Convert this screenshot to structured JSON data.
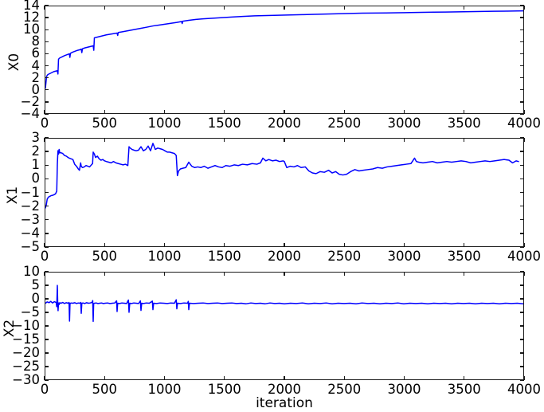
{
  "chart_data": [
    {
      "type": "line",
      "panel_index": 0,
      "title": "",
      "xlabel": "",
      "ylabel": "X0",
      "xlim": [
        0,
        4000
      ],
      "ylim": [
        -4,
        14
      ],
      "xticks": [
        0,
        500,
        1000,
        1500,
        2000,
        2500,
        3000,
        3500,
        4000
      ],
      "yticks": [
        -4,
        -2,
        0,
        2,
        4,
        6,
        8,
        10,
        12,
        14
      ],
      "grid": false,
      "legend": null,
      "line_color": "#0000ff",
      "series": [
        {
          "name": "X0",
          "x": [
            0,
            10,
            20,
            30,
            40,
            50,
            60,
            70,
            80,
            90,
            100,
            105,
            110,
            120,
            140,
            160,
            180,
            200,
            205,
            210,
            230,
            250,
            270,
            290,
            300,
            305,
            310,
            330,
            350,
            370,
            390,
            400,
            405,
            410,
            430,
            450,
            470,
            490,
            510,
            540,
            570,
            600,
            605,
            610,
            640,
            680,
            720,
            760,
            800,
            850,
            900,
            950,
            1000,
            1050,
            1100,
            1140,
            1145,
            1150,
            1200,
            1260,
            1320,
            1400,
            1480,
            1560,
            1650,
            1750,
            1850,
            1950,
            2050,
            2150,
            2250,
            2350,
            2450,
            2550,
            2650,
            2750,
            2850,
            2950,
            3050,
            3150,
            3250,
            3350,
            3450,
            3550,
            3650,
            3750,
            3850,
            3950,
            4000
          ],
          "y": [
            0.2,
            2.2,
            2.5,
            2.6,
            2.7,
            2.8,
            2.9,
            3.0,
            3.05,
            3.1,
            3.15,
            2.6,
            5.1,
            5.3,
            5.5,
            5.7,
            5.85,
            6.0,
            5.4,
            6.1,
            6.3,
            6.45,
            6.6,
            6.7,
            6.8,
            6.2,
            6.85,
            7.0,
            7.1,
            7.2,
            7.3,
            7.35,
            6.6,
            8.7,
            8.8,
            8.9,
            9.0,
            9.1,
            9.2,
            9.3,
            9.4,
            9.5,
            9.1,
            9.6,
            9.7,
            9.85,
            10.0,
            10.15,
            10.3,
            10.5,
            10.7,
            10.85,
            11.0,
            11.15,
            11.3,
            11.45,
            11.1,
            11.5,
            11.65,
            11.8,
            11.9,
            12.0,
            12.1,
            12.2,
            12.3,
            12.4,
            12.45,
            12.5,
            12.55,
            12.6,
            12.65,
            12.7,
            12.75,
            12.8,
            12.85,
            12.88,
            12.9,
            12.93,
            12.96,
            12.99,
            13.02,
            13.05,
            13.08,
            13.11,
            13.14,
            13.17,
            13.2,
            13.22,
            13.25
          ]
        }
      ]
    },
    {
      "type": "line",
      "panel_index": 1,
      "title": "",
      "xlabel": "",
      "ylabel": "X1",
      "xlim": [
        0,
        4000
      ],
      "ylim": [
        -5,
        3
      ],
      "xticks": [
        0,
        500,
        1000,
        1500,
        2000,
        2500,
        3000,
        3500,
        4000
      ],
      "yticks": [
        -5,
        -4,
        -3,
        -2,
        -1,
        0,
        1,
        2,
        3
      ],
      "grid": false,
      "legend": null,
      "line_color": "#0000ff",
      "series": [
        {
          "name": "X1",
          "x": [
            0,
            8,
            15,
            25,
            35,
            45,
            55,
            65,
            75,
            85,
            95,
            100,
            105,
            110,
            115,
            120,
            130,
            145,
            160,
            175,
            190,
            200,
            215,
            230,
            245,
            260,
            275,
            285,
            295,
            300,
            310,
            325,
            340,
            355,
            370,
            385,
            395,
            400,
            410,
            420,
            435,
            450,
            465,
            480,
            495,
            510,
            530,
            550,
            570,
            590,
            610,
            630,
            650,
            670,
            690,
            700,
            710,
            725,
            740,
            760,
            780,
            800,
            820,
            840,
            860,
            880,
            900,
            920,
            940,
            960,
            980,
            1000,
            1020,
            1040,
            1060,
            1080,
            1095,
            1105,
            1115,
            1130,
            1150,
            1175,
            1200,
            1225,
            1250,
            1275,
            1300,
            1330,
            1360,
            1390,
            1420,
            1450,
            1480,
            1510,
            1545,
            1580,
            1615,
            1650,
            1690,
            1730,
            1770,
            1800,
            1820,
            1845,
            1870,
            1900,
            1930,
            1960,
            1990,
            2000,
            2020,
            2050,
            2080,
            2110,
            2140,
            2175,
            2205,
            2235,
            2265,
            2300,
            2335,
            2370,
            2400,
            2430,
            2460,
            2490,
            2520,
            2555,
            2590,
            2625,
            2660,
            2700,
            2740,
            2780,
            2820,
            2860,
            2900,
            2940,
            2980,
            3020,
            3060,
            3090,
            3105,
            3125,
            3160,
            3200,
            3240,
            3280,
            3320,
            3360,
            3400,
            3440,
            3480,
            3520,
            3560,
            3600,
            3640,
            3680,
            3720,
            3760,
            3800,
            3840,
            3880,
            3910,
            3940,
            3960,
            3980,
            4000
          ],
          "y": [
            -2.15,
            -1.9,
            -1.5,
            -1.35,
            -1.3,
            -1.25,
            -1.22,
            -1.2,
            -1.15,
            -1.1,
            -0.9,
            1.1,
            2.1,
            1.85,
            2.2,
            1.95,
            1.95,
            1.9,
            1.75,
            1.7,
            1.6,
            1.55,
            1.5,
            1.45,
            1.1,
            0.95,
            0.75,
            0.65,
            1.2,
            0.95,
            0.85,
            0.9,
            1.0,
            0.95,
            0.9,
            1.05,
            1.15,
            2.0,
            1.85,
            1.6,
            1.7,
            1.5,
            1.4,
            1.45,
            1.35,
            1.3,
            1.25,
            1.2,
            1.3,
            1.2,
            1.15,
            1.1,
            1.05,
            1.1,
            1.0,
            2.4,
            2.3,
            2.2,
            2.15,
            2.1,
            2.15,
            2.4,
            2.1,
            2.2,
            2.45,
            2.1,
            2.65,
            2.2,
            2.3,
            2.25,
            2.2,
            2.1,
            2.0,
            2.0,
            1.95,
            1.9,
            1.75,
            0.25,
            0.6,
            0.75,
            0.8,
            0.85,
            1.25,
            0.95,
            0.85,
            0.9,
            0.85,
            0.95,
            0.8,
            0.9,
            1.0,
            0.9,
            0.85,
            1.0,
            0.95,
            1.05,
            1.0,
            1.1,
            1.05,
            1.15,
            1.1,
            1.2,
            1.55,
            1.35,
            1.45,
            1.35,
            1.4,
            1.3,
            1.35,
            1.3,
            0.85,
            0.95,
            0.9,
            1.0,
            0.85,
            0.9,
            0.6,
            0.45,
            0.4,
            0.55,
            0.5,
            0.65,
            0.45,
            0.55,
            0.35,
            0.3,
            0.35,
            0.55,
            0.7,
            0.6,
            0.65,
            0.7,
            0.75,
            0.85,
            0.8,
            0.9,
            0.95,
            1.0,
            1.05,
            1.1,
            1.15,
            1.55,
            1.3,
            1.25,
            1.2,
            1.25,
            1.3,
            1.2,
            1.25,
            1.3,
            1.25,
            1.3,
            1.35,
            1.3,
            1.2,
            1.25,
            1.3,
            1.35,
            1.3,
            1.35,
            1.4,
            1.45,
            1.4,
            1.2,
            1.35,
            1.3
          ]
        }
      ]
    },
    {
      "type": "line",
      "panel_index": 2,
      "title": "",
      "xlabel": "iteration",
      "ylabel": "X2",
      "xlim": [
        0,
        4000
      ],
      "ylim": [
        -30,
        10
      ],
      "xticks": [
        0,
        500,
        1000,
        1500,
        2000,
        2500,
        3000,
        3500,
        4000
      ],
      "yticks": [
        -30,
        -25,
        -20,
        -15,
        -10,
        -5,
        0,
        5,
        10
      ],
      "grid": false,
      "legend": null,
      "line_color": "#0000ff",
      "note": "Noisy trace oscillating near -1.5 with large transient downward spikes early (to about -8) and one upward spike near iteration 100 (to about +5); spike amplitude decays with iteration.",
      "series": [
        {
          "name": "X2",
          "x": [
            0,
            15,
            30,
            45,
            60,
            75,
            90,
            95,
            100,
            103,
            106,
            110,
            115,
            120,
            130,
            145,
            160,
            175,
            190,
            198,
            202,
            206,
            215,
            230,
            245,
            260,
            275,
            290,
            296,
            300,
            305,
            315,
            330,
            345,
            360,
            375,
            390,
            396,
            400,
            404,
            410,
            425,
            440,
            455,
            470,
            485,
            500,
            520,
            540,
            560,
            580,
            596,
            600,
            605,
            620,
            640,
            660,
            680,
            695,
            700,
            706,
            720,
            740,
            760,
            780,
            795,
            800,
            806,
            820,
            845,
            870,
            895,
            900,
            906,
            930,
            960,
            990,
            1020,
            1050,
            1080,
            1095,
            1100,
            1106,
            1130,
            1160,
            1190,
            1196,
            1200,
            1206,
            1240,
            1280,
            1320,
            1360,
            1400,
            1440,
            1480,
            1520,
            1560,
            1600,
            1640,
            1680,
            1720,
            1760,
            1800,
            1840,
            1880,
            1920,
            1960,
            2000,
            2050,
            2100,
            2150,
            2200,
            2250,
            2300,
            2350,
            2400,
            2450,
            2500,
            2550,
            2600,
            2650,
            2700,
            2750,
            2800,
            2850,
            2900,
            2950,
            3000,
            3050,
            3100,
            3150,
            3200,
            3250,
            3300,
            3350,
            3400,
            3450,
            3500,
            3550,
            3600,
            3650,
            3700,
            3750,
            3800,
            3850,
            3900,
            3950,
            4000
          ],
          "y": [
            -1.5,
            -1.0,
            -1.3,
            -0.8,
            -1.4,
            -0.9,
            -1.2,
            -2.8,
            5.2,
            -1.0,
            -4.3,
            -1.4,
            -2.0,
            -1.3,
            -1.5,
            -1.2,
            -1.6,
            -1.3,
            -1.5,
            -1.2,
            -8.2,
            -1.6,
            -1.4,
            -1.5,
            -1.3,
            -1.6,
            -1.4,
            -1.5,
            -1.2,
            -5.3,
            -1.5,
            -1.4,
            -1.6,
            -1.3,
            -1.5,
            -1.4,
            -1.2,
            -0.5,
            -8.3,
            -1.6,
            -1.5,
            -1.4,
            -1.6,
            -1.5,
            -1.4,
            -1.6,
            -1.5,
            -1.4,
            -1.6,
            -1.5,
            -1.4,
            -0.6,
            -4.6,
            -1.5,
            -1.6,
            -1.4,
            -1.5,
            -1.6,
            -0.3,
            -4.9,
            -1.5,
            -1.6,
            -1.4,
            -1.5,
            -1.6,
            -0.6,
            -4.2,
            -1.5,
            -1.6,
            -1.4,
            -1.5,
            -0.7,
            -3.9,
            -1.5,
            -1.6,
            -1.4,
            -1.5,
            -1.6,
            -1.4,
            -1.5,
            -0.2,
            -3.6,
            -1.5,
            -1.6,
            -1.4,
            -1.5,
            -0.8,
            -3.9,
            -1.5,
            -1.6,
            -1.5,
            -1.4,
            -1.6,
            -1.5,
            -1.4,
            -1.6,
            -1.5,
            -1.4,
            -1.6,
            -1.5,
            -1.7,
            -1.4,
            -1.6,
            -1.5,
            -1.7,
            -1.4,
            -1.6,
            -1.5,
            -1.7,
            -1.5,
            -1.6,
            -1.4,
            -1.7,
            -1.5,
            -1.6,
            -1.4,
            -1.7,
            -1.5,
            -1.6,
            -1.5,
            -1.7,
            -1.4,
            -1.6,
            -1.5,
            -1.7,
            -1.5,
            -1.6,
            -1.4,
            -1.7,
            -1.5,
            -1.6,
            -1.5,
            -1.7,
            -1.5,
            -1.6,
            -1.5,
            -1.7,
            -1.5,
            -1.6,
            -1.5,
            -1.7,
            -1.5,
            -1.6,
            -1.5,
            -1.7,
            -1.5,
            -1.6,
            -1.5,
            -1.7,
            -1.6,
            -1.6
          ]
        }
      ]
    }
  ],
  "figure": {
    "background_color": "#ffffff",
    "axis_color": "#1a1a1a",
    "line_color": "#0000ff",
    "xlabel": "iteration",
    "panels": [
      {
        "ylabel": "X0",
        "yticks": [
          "14",
          "12",
          "10",
          "8",
          "6",
          "4",
          "2",
          "0",
          "−2",
          "−4"
        ],
        "xticks": [
          "0",
          "500",
          "1000",
          "1500",
          "2000",
          "2500",
          "3000",
          "3500",
          "4000"
        ]
      },
      {
        "ylabel": "X1",
        "yticks": [
          "3",
          "2",
          "1",
          "0",
          "−1",
          "−2",
          "−3",
          "−4",
          "−5"
        ],
        "xticks": [
          "0",
          "500",
          "1000",
          "1500",
          "2000",
          "2500",
          "3000",
          "3500",
          "4000"
        ]
      },
      {
        "ylabel": "X2",
        "yticks": [
          "10",
          "5",
          "0",
          "−5",
          "−10",
          "−15",
          "−20",
          "−25",
          "−30"
        ],
        "xticks": [
          "0",
          "500",
          "1000",
          "1500",
          "2000",
          "2500",
          "3000",
          "3500",
          "4000"
        ]
      }
    ]
  }
}
